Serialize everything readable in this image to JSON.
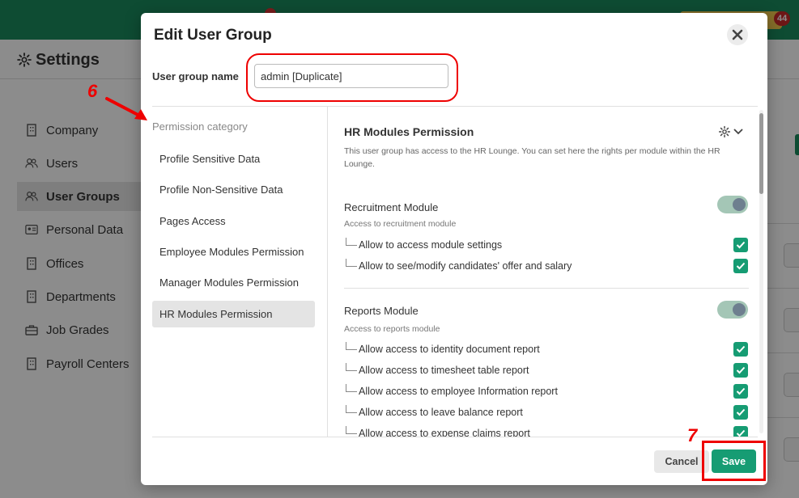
{
  "app": {
    "notification_count": "44",
    "settings_title": "Settings",
    "sidebar": [
      {
        "label": "Company",
        "icon": "building-icon"
      },
      {
        "label": "Users",
        "icon": "users-icon"
      },
      {
        "label": "User Groups",
        "icon": "users-icon",
        "active": true
      },
      {
        "label": "Personal Data",
        "icon": "id-card-icon"
      },
      {
        "label": "Offices",
        "icon": "building-icon"
      },
      {
        "label": "Departments",
        "icon": "building-icon"
      },
      {
        "label": "Job Grades",
        "icon": "briefcase-icon"
      },
      {
        "label": "Payroll Centers",
        "icon": "building-icon"
      }
    ]
  },
  "modal": {
    "title": "Edit User Group",
    "name_label": "User group name",
    "name_value": "admin [Duplicate]",
    "category_heading": "Permission category",
    "categories": [
      {
        "label": "Profile Sensitive Data"
      },
      {
        "label": "Profile Non-Sensitive Data"
      },
      {
        "label": "Pages Access"
      },
      {
        "label": "Employee Modules Permission"
      },
      {
        "label": "Manager Modules Permission"
      },
      {
        "label": "HR Modules Permission",
        "active": true
      }
    ],
    "panel": {
      "title": "HR Modules Permission",
      "description": "This user group has access to the HR Lounge. You can set here the rights per module within the HR Lounge.",
      "modules": [
        {
          "title": "Recruitment Module",
          "subtitle": "Access to recruitment module",
          "enabled": true,
          "permissions": [
            {
              "label": "Allow to access module settings",
              "checked": true
            },
            {
              "label": "Allow to see/modify candidates' offer and salary",
              "checked": true
            }
          ]
        },
        {
          "title": "Reports Module",
          "subtitle": "Access to reports module",
          "enabled": true,
          "permissions": [
            {
              "label": "Allow access to identity document report",
              "checked": true
            },
            {
              "label": "Allow access to timesheet table report",
              "checked": true
            },
            {
              "label": "Allow access to employee Information report",
              "checked": true
            },
            {
              "label": "Allow access to leave balance report",
              "checked": true
            },
            {
              "label": "Allow access to expense claims report",
              "checked": true
            }
          ]
        }
      ]
    },
    "cancel_label": "Cancel",
    "save_label": "Save"
  },
  "annotations": {
    "step_6": "6",
    "step_7": "7"
  },
  "colors": {
    "brand_green": "#1a8a5e",
    "checkbox_green": "#169c73",
    "annotation_red": "#e00000"
  }
}
